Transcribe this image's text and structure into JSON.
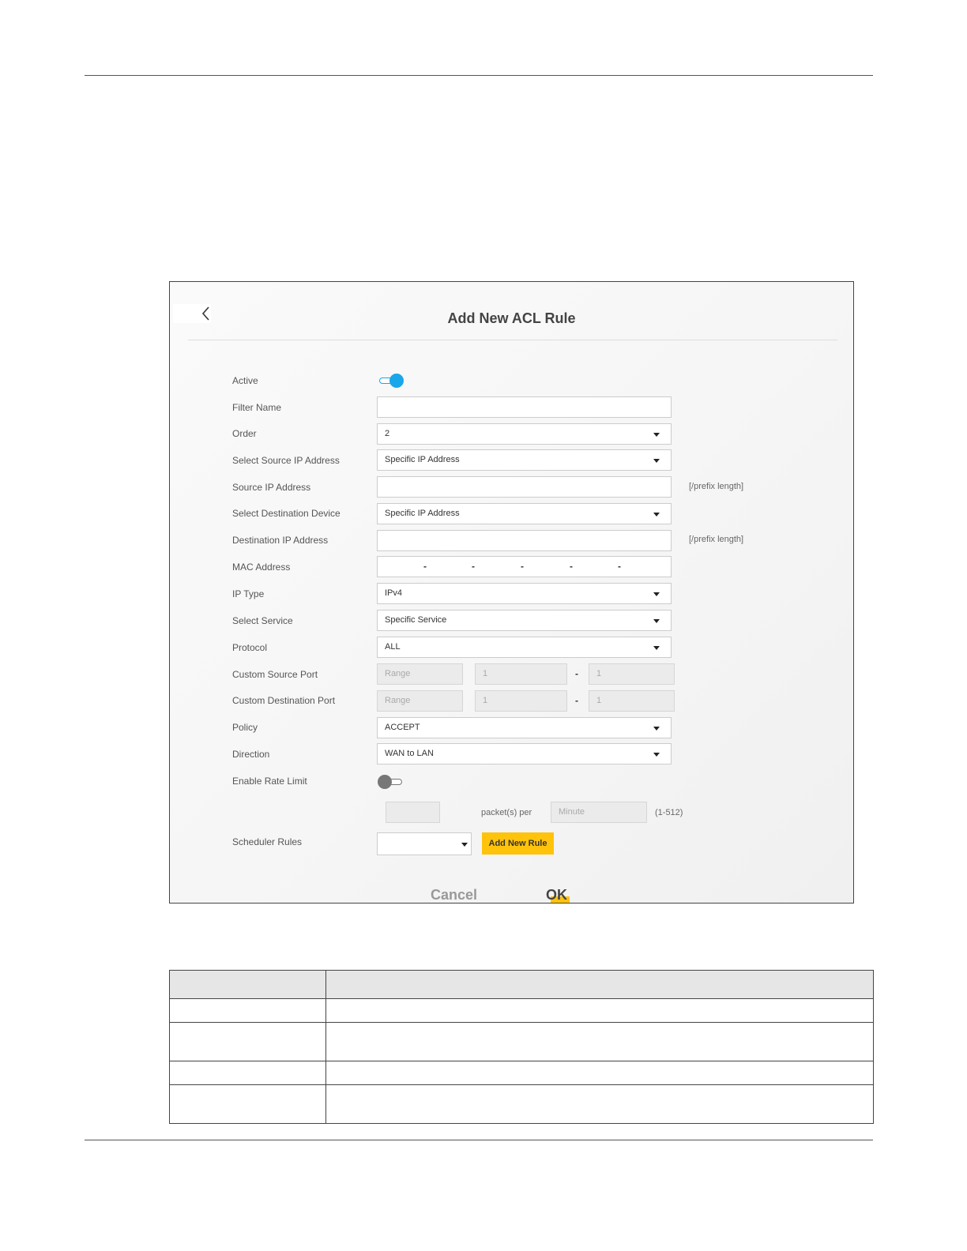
{
  "dialog": {
    "title": "Add New ACL Rule",
    "back_icon": "chevron-left-icon"
  },
  "form": {
    "active": {
      "label": "Active",
      "on": true
    },
    "filter_name": {
      "label": "Filter Name",
      "value": ""
    },
    "order": {
      "label": "Order",
      "value": "2"
    },
    "select_source_ip": {
      "label": "Select Source IP Address",
      "value": "Specific IP Address"
    },
    "source_ip": {
      "label": "Source IP Address",
      "value": "",
      "hint": "[/prefix length]"
    },
    "select_dest_device": {
      "label": "Select Destination Device",
      "value": "Specific IP Address"
    },
    "dest_ip": {
      "label": "Destination IP Address",
      "value": "",
      "hint": "[/prefix length]"
    },
    "mac_address": {
      "label": "MAC Address",
      "separator": "-"
    },
    "ip_type": {
      "label": "IP Type",
      "value": "IPv4"
    },
    "select_service": {
      "label": "Select Service",
      "value": "Specific Service"
    },
    "protocol": {
      "label": "Protocol",
      "value": "ALL"
    },
    "custom_source_port": {
      "label": "Custom Source Port",
      "mode": "Range",
      "start": "1",
      "end": "1",
      "separator": "-"
    },
    "custom_dest_port": {
      "label": "Custom Destination Port",
      "mode": "Range",
      "start": "1",
      "end": "1",
      "separator": "-"
    },
    "policy": {
      "label": "Policy",
      "value": "ACCEPT"
    },
    "direction": {
      "label": "Direction",
      "value": "WAN to LAN"
    },
    "enable_rate_limit": {
      "label": "Enable Rate Limit",
      "on": false
    },
    "rate": {
      "value": "",
      "unit_text": "packet(s) per",
      "period": "Minute",
      "range_hint": "(1-512)"
    },
    "scheduler_rules": {
      "label": "Scheduler Rules",
      "value": "",
      "add_button": "Add New Rule"
    }
  },
  "actions": {
    "cancel": "Cancel",
    "ok": "OK"
  },
  "colors": {
    "accent": "#1aa6ea",
    "button_yellow": "#ffc30b"
  }
}
